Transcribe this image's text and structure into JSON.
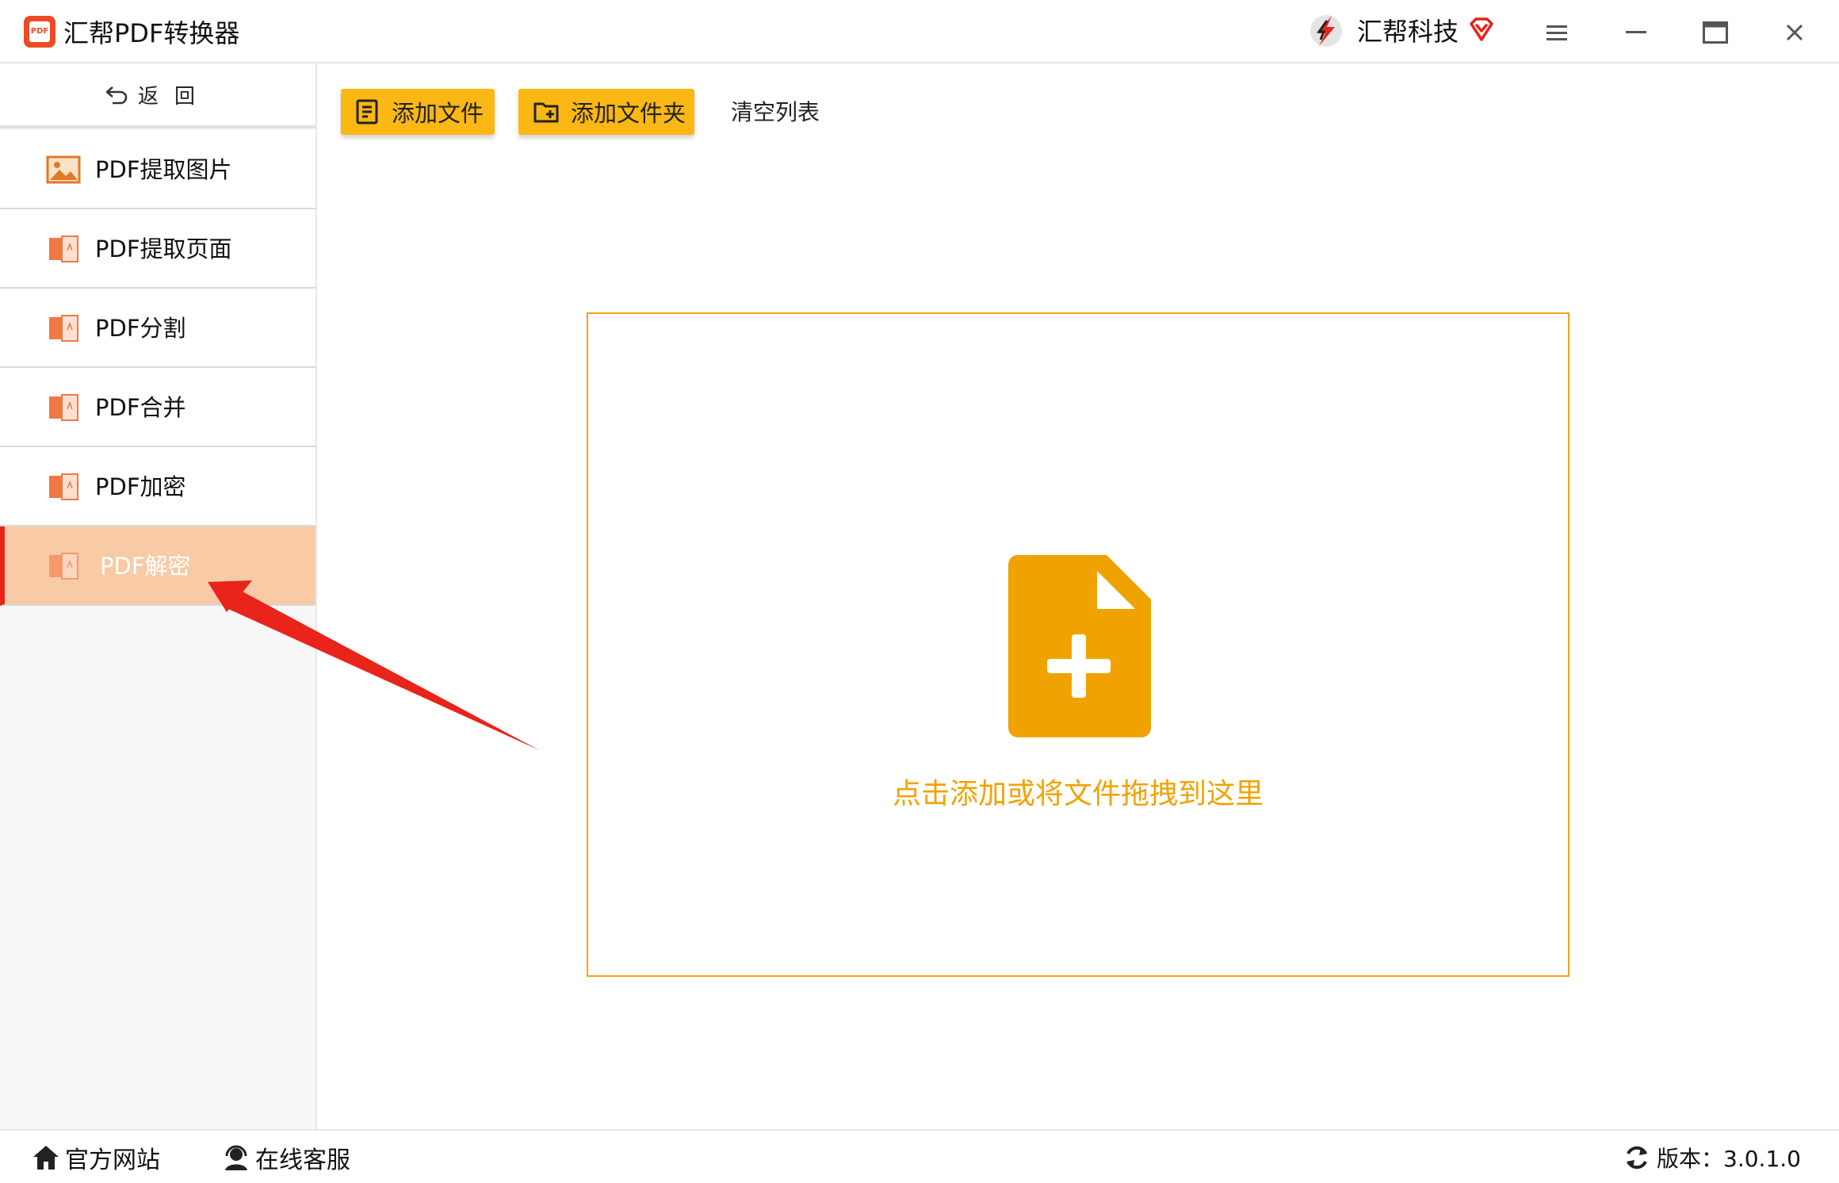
{
  "window": {
    "app_title": "汇帮PDF转换器",
    "app_logo_text": "PDF",
    "brand_name": "汇帮科技"
  },
  "sidebar": {
    "back_label": "返回",
    "items": [
      {
        "label": "PDF提取图片",
        "icon": "image-icon",
        "active": false
      },
      {
        "label": "PDF提取页面",
        "icon": "pdf-file-icon",
        "active": false
      },
      {
        "label": "PDF分割",
        "icon": "pdf-file-icon",
        "active": false
      },
      {
        "label": "PDF合并",
        "icon": "pdf-file-icon",
        "active": false
      },
      {
        "label": "PDF加密",
        "icon": "pdf-file-icon",
        "active": false
      },
      {
        "label": "PDF解密",
        "icon": "pdf-file-icon",
        "active": true
      }
    ]
  },
  "toolbar": {
    "add_file_label": "添加文件",
    "add_folder_label": "添加文件夹",
    "clear_list_label": "清空列表"
  },
  "dropzone": {
    "hint": "点击添加或将文件拖拽到这里",
    "icon": "add-file-icon"
  },
  "statusbar": {
    "official_site_label": "官方网站",
    "online_service_label": "在线客服",
    "version_label": "版本：3.0.1.0"
  },
  "colors": {
    "accent_yellow": "#fbb714",
    "drop_orange": "#f0a300",
    "active_item_bg": "#f8cba6",
    "active_marker": "#e8241b",
    "annotation_arrow": "#e8241b"
  }
}
